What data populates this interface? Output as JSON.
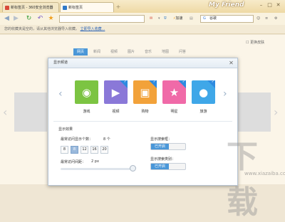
{
  "tabs": [
    {
      "label": "新标签页 - 360安全浏览器",
      "active": false,
      "favicon_color": "#d84a3a"
    },
    {
      "label": "新标签页",
      "active": true,
      "favicon_color": "#2f79c8"
    }
  ],
  "window": {
    "brand": "My Friend"
  },
  "toolbar": {
    "speedup_label": "加速",
    "speedup_icon": "lightning-icon",
    "search_placeholder": "谷歌"
  },
  "bookmark_bar": {
    "message": "您的收藏夹是空的，请从其他浏览器导入收藏。",
    "link": "立即导入收藏..."
  },
  "page": {
    "skin_link": "更换皮肤",
    "nav": [
      "网页",
      "新闻",
      "视频",
      "图片",
      "音乐",
      "地图",
      "问答"
    ],
    "nav_active_index": 0
  },
  "dialog": {
    "title": "显示频道",
    "categories": [
      {
        "label": "游戏",
        "icon": "gamepad-icon",
        "color": "#7cc442",
        "glyph": "🎮",
        "checked": false
      },
      {
        "label": "视频",
        "icon": "tv-icon",
        "color": "#8a78d8",
        "glyph": "▶",
        "checked": true
      },
      {
        "label": "购物",
        "icon": "shopping-bag-icon",
        "color": "#f2a23a",
        "glyph": "👜",
        "checked": true
      },
      {
        "label": "明星",
        "icon": "star-icon",
        "color": "#f06aa8",
        "glyph": "★",
        "checked": true
      },
      {
        "label": "旅游",
        "icon": "balloon-icon",
        "color": "#3fa7e8",
        "glyph": "🎈",
        "checked": true
      }
    ],
    "display_section": "显示效果",
    "max_visits_label": "最常访问显示个数：",
    "max_visits_value": "8 个",
    "count_options": [
      "8",
      "8",
      "12",
      "16",
      "20"
    ],
    "count_selected_index": 1,
    "spacing_label": "最常访问间距：",
    "spacing_value": "2 px",
    "search_box_label": "显示搜索框：",
    "search_box_state": "已开启",
    "search_type_label": "显示搜索类别：",
    "search_type_state": "已开启"
  },
  "watermark": {
    "big": "下载",
    "small": "www.xiazaiba.com"
  }
}
